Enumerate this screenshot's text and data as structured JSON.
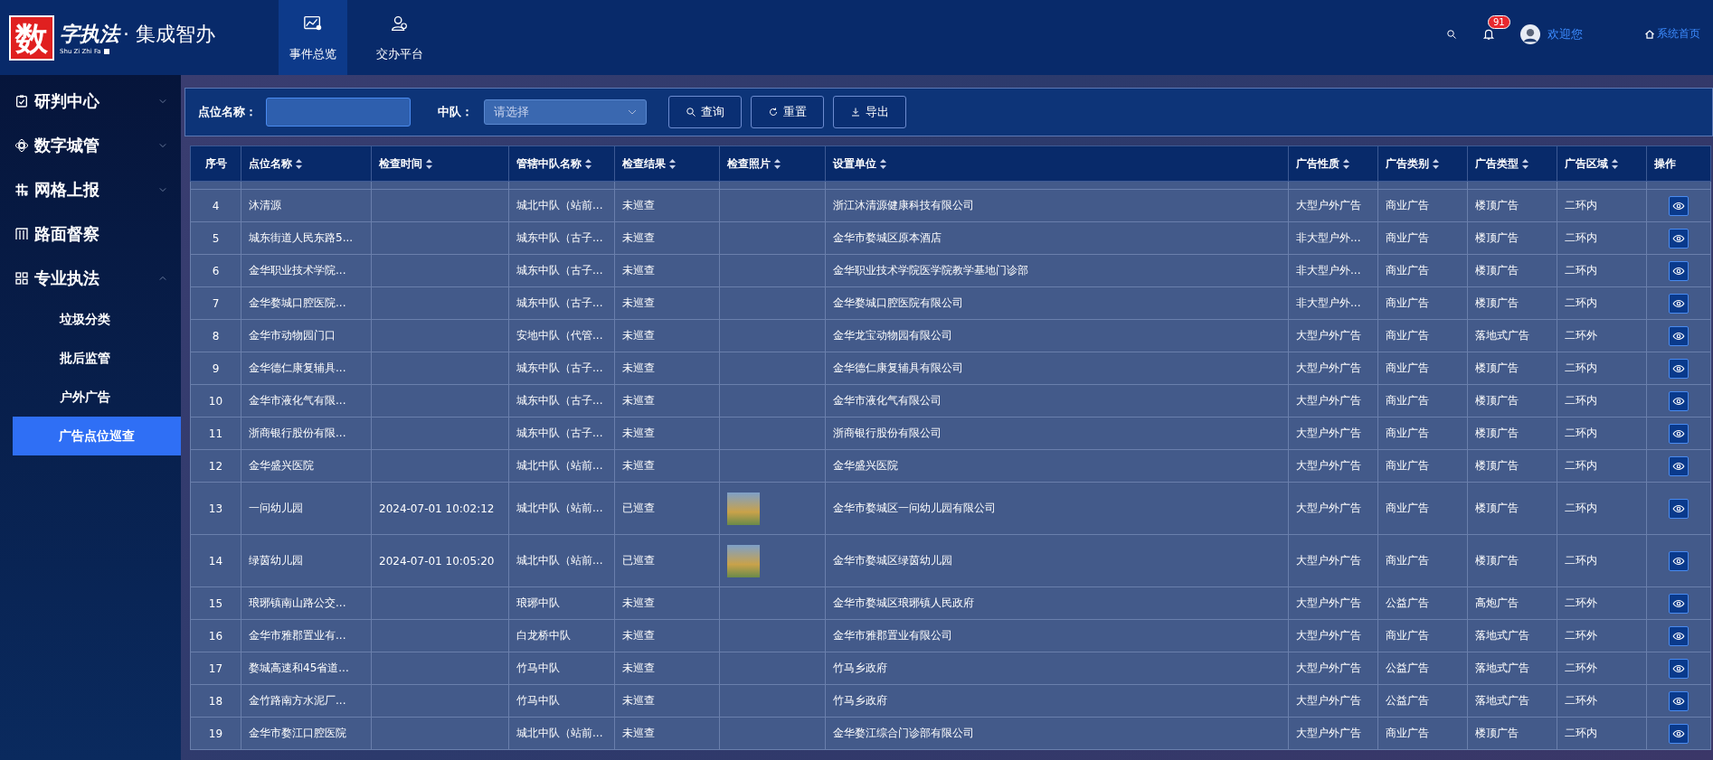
{
  "logo": {
    "mark": "数",
    "brush": "字执法",
    "title": "· 集成智办",
    "subtitle": "Shu Zi Zhi Fa"
  },
  "nav": [
    {
      "label": "事件总览",
      "selected": true
    },
    {
      "label": "交办平台",
      "selected": false
    }
  ],
  "header": {
    "badge": "91",
    "welcome": "欢迎您",
    "home": "系统首页"
  },
  "sidebar": {
    "items": [
      {
        "label": "研判中心",
        "expanded": false
      },
      {
        "label": "数字城管",
        "expanded": false
      },
      {
        "label": "网格上报",
        "expanded": false
      },
      {
        "label": "路面督察"
      },
      {
        "label": "专业执法",
        "expanded": true,
        "children": [
          {
            "label": "垃圾分类",
            "selected": false
          },
          {
            "label": "批后监管",
            "selected": false
          },
          {
            "label": "户外广告",
            "selected": false
          },
          {
            "label": "广告点位巡查",
            "selected": true
          }
        ]
      }
    ]
  },
  "filters": {
    "name_label": "点位名称：",
    "team_label": "中队：",
    "team_placeholder": "请选择",
    "buttons": [
      {
        "label": "查询"
      },
      {
        "label": "重置"
      },
      {
        "label": "导出"
      }
    ]
  },
  "table": {
    "columns": [
      {
        "label": "序号",
        "sortable": false
      },
      {
        "label": "点位名称",
        "sortable": true
      },
      {
        "label": "检查时间",
        "sortable": true
      },
      {
        "label": "管辖中队名称",
        "sortable": true
      },
      {
        "label": "检查结果",
        "sortable": true
      },
      {
        "label": "检查照片",
        "sortable": true
      },
      {
        "label": "设置单位",
        "sortable": true
      },
      {
        "label": "广告性质",
        "sortable": true
      },
      {
        "label": "广告类别",
        "sortable": true
      },
      {
        "label": "广告类型",
        "sortable": true
      },
      {
        "label": "广告区域",
        "sortable": true
      },
      {
        "label": "操作",
        "sortable": false
      }
    ],
    "rows": [
      {
        "no": "4",
        "name": "沐清源",
        "team": "城北中队（站前...",
        "result": "未巡查",
        "photo": false,
        "unit": "浙江沐清源健康科技有限公司",
        "nature": "大型户外广告",
        "category": "商业广告",
        "type": "楼顶广告",
        "area": "二环内"
      },
      {
        "no": "5",
        "name": "城东街道人民东路5...",
        "team": "城东中队（古子...",
        "result": "未巡查",
        "photo": false,
        "unit": "金华市婺城区原本酒店",
        "nature": "非大型户外...",
        "category": "商业广告",
        "type": "楼顶广告",
        "area": "二环内"
      },
      {
        "no": "6",
        "name": "金华职业技术学院...",
        "team": "城东中队（古子...",
        "result": "未巡查",
        "photo": false,
        "unit": "金华职业技术学院医学院教学基地门诊部",
        "nature": "非大型户外...",
        "category": "商业广告",
        "type": "楼顶广告",
        "area": "二环内"
      },
      {
        "no": "7",
        "name": "金华婺城口腔医院...",
        "team": "城东中队（古子...",
        "result": "未巡查",
        "photo": false,
        "unit": "金华婺城口腔医院有限公司",
        "nature": "非大型户外...",
        "category": "商业广告",
        "type": "楼顶广告",
        "area": "二环内"
      },
      {
        "no": "8",
        "name": "金华市动物园门口",
        "team": "安地中队（代管...",
        "result": "未巡查",
        "photo": false,
        "unit": "金华龙宝动物园有限公司",
        "nature": "大型户外广告",
        "category": "商业广告",
        "type": "落地式广告",
        "area": "二环外"
      },
      {
        "no": "9",
        "name": "金华德仁康复辅具...",
        "team": "城东中队（古子...",
        "result": "未巡查",
        "photo": false,
        "unit": "金华德仁康复辅具有限公司",
        "nature": "大型户外广告",
        "category": "商业广告",
        "type": "楼顶广告",
        "area": "二环内"
      },
      {
        "no": "10",
        "name": "金华市液化气有限...",
        "team": "城东中队（古子...",
        "result": "未巡查",
        "photo": false,
        "unit": "金华市液化气有限公司",
        "nature": "大型户外广告",
        "category": "商业广告",
        "type": "楼顶广告",
        "area": "二环内"
      },
      {
        "no": "11",
        "name": "浙商银行股份有限...",
        "team": "城东中队（古子...",
        "result": "未巡查",
        "photo": false,
        "unit": "浙商银行股份有限公司",
        "nature": "大型户外广告",
        "category": "商业广告",
        "type": "楼顶广告",
        "area": "二环内"
      },
      {
        "no": "12",
        "name": "金华盛兴医院",
        "team": "城北中队（站前...",
        "result": "未巡查",
        "photo": false,
        "unit": "金华盛兴医院",
        "nature": "大型户外广告",
        "category": "商业广告",
        "type": "楼顶广告",
        "area": "二环内"
      },
      {
        "no": "13",
        "name": "一问幼儿园",
        "time": "2024-07-01 10:02:12",
        "team": "城北中队（站前...",
        "result": "已巡查",
        "photo": true,
        "unit": "金华市婺城区一问幼儿园有限公司",
        "nature": "大型户外广告",
        "category": "商业广告",
        "type": "楼顶广告",
        "area": "二环内"
      },
      {
        "no": "14",
        "name": "绿茵幼儿园",
        "time": "2024-07-01 10:05:20",
        "team": "城北中队（站前...",
        "result": "已巡查",
        "photo": true,
        "unit": "金华市婺城区绿茵幼儿园",
        "nature": "大型户外广告",
        "category": "商业广告",
        "type": "楼顶广告",
        "area": "二环内"
      },
      {
        "no": "15",
        "name": "琅琊镇南山路公交...",
        "team": "琅琊中队",
        "result": "未巡查",
        "photo": false,
        "unit": "金华市婺城区琅琊镇人民政府",
        "nature": "大型户外广告",
        "category": "公益广告",
        "type": "高炮广告",
        "area": "二环外"
      },
      {
        "no": "16",
        "name": "金华市雅郡置业有...",
        "team": "白龙桥中队",
        "result": "未巡查",
        "photo": false,
        "unit": "金华市雅郡置业有限公司",
        "nature": "大型户外广告",
        "category": "商业广告",
        "type": "落地式广告",
        "area": "二环外"
      },
      {
        "no": "17",
        "name": "婺城高速和45省道...",
        "team": "竹马中队",
        "result": "未巡查",
        "photo": false,
        "unit": "竹马乡政府",
        "nature": "大型户外广告",
        "category": "公益广告",
        "type": "落地式广告",
        "area": "二环外"
      },
      {
        "no": "18",
        "name": "金竹路南方水泥厂...",
        "team": "竹马中队",
        "result": "未巡查",
        "photo": false,
        "unit": "竹马乡政府",
        "nature": "大型户外广告",
        "category": "公益广告",
        "type": "落地式广告",
        "area": "二环外"
      },
      {
        "no": "19",
        "name": "金华市婺江口腔医院",
        "team": "城北中队（站前...",
        "result": "未巡查",
        "photo": false,
        "unit": "金华婺江综合门诊部有限公司",
        "nature": "大型户外广告",
        "category": "商业广告",
        "type": "楼顶广告",
        "area": "二环内"
      }
    ]
  }
}
